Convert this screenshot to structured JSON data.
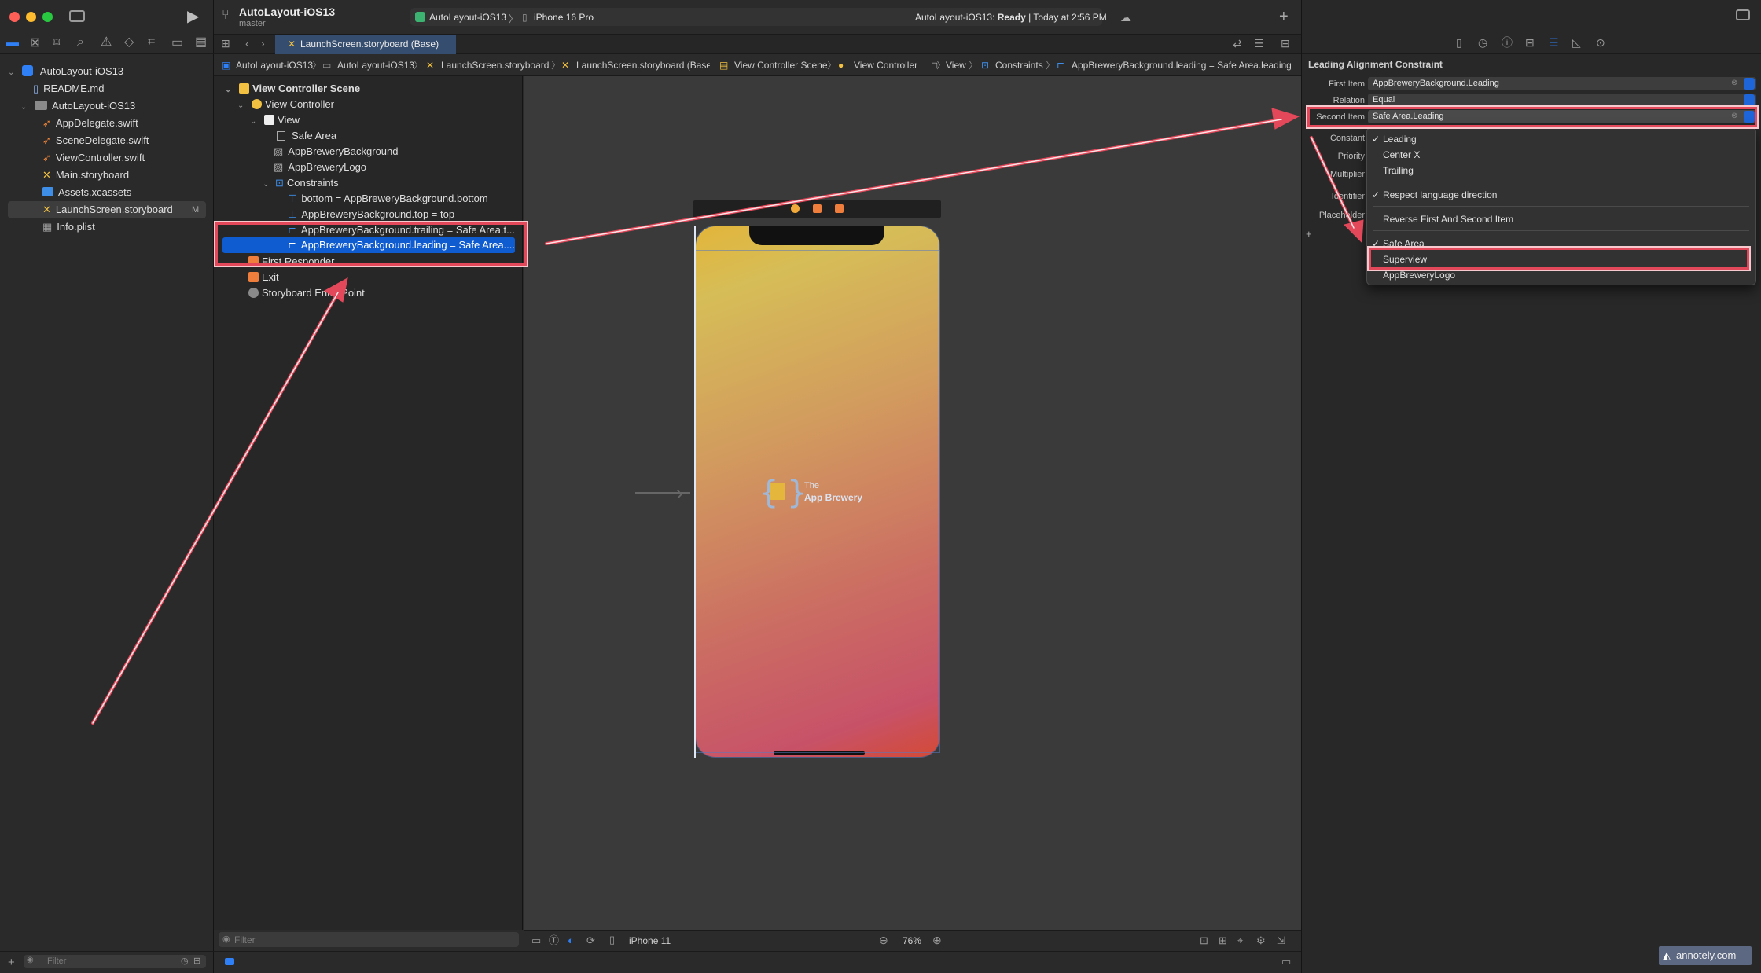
{
  "toolbar": {
    "project_title": "AutoLayout-iOS13",
    "branch": "master",
    "scheme": "AutoLayout-iOS13",
    "device": "iPhone 16 Pro",
    "status_prefix": "AutoLayout-iOS13: ",
    "status_state": "Ready",
    "status_time": " | Today at 2:56 PM"
  },
  "navigator": {
    "items": [
      {
        "label": "AutoLayout-iOS13",
        "kind": "project-icon"
      },
      {
        "label": "README.md",
        "kind": "book-icon"
      },
      {
        "label": "AutoLayout-iOS13",
        "kind": "folder-icon"
      },
      {
        "label": "AppDelegate.swift",
        "kind": "swift-icon"
      },
      {
        "label": "SceneDelegate.swift",
        "kind": "swift-icon"
      },
      {
        "label": "ViewController.swift",
        "kind": "swift-icon"
      },
      {
        "label": "Main.storyboard",
        "kind": "storyboard-icon"
      },
      {
        "label": "Assets.xcassets",
        "kind": "assets-icon"
      },
      {
        "label": "LaunchScreen.storyboard",
        "kind": "storyboard-icon",
        "badge": "M"
      },
      {
        "label": "Info.plist",
        "kind": "plist-icon"
      }
    ],
    "filter_placeholder": "Filter"
  },
  "editor": {
    "tab_label": "LaunchScreen.storyboard (Base)",
    "breadcrumb": [
      "AutoLayout-iOS13",
      "AutoLayout-iOS13",
      "LaunchScreen.storyboard",
      "LaunchScreen.storyboard (Base)",
      "View Controller Scene",
      "View Controller",
      "View",
      "Constraints",
      "AppBreweryBackground.leading = Safe Area.leading"
    ]
  },
  "outline": {
    "items": [
      {
        "label": "View Controller Scene"
      },
      {
        "label": "View Controller"
      },
      {
        "label": "View"
      },
      {
        "label": "Safe Area"
      },
      {
        "label": "AppBreweryBackground"
      },
      {
        "label": "AppBreweryLogo"
      },
      {
        "label": "Constraints"
      },
      {
        "label": "bottom = AppBreweryBackground.bottom"
      },
      {
        "label": "AppBreweryBackground.top = top"
      },
      {
        "label": "AppBreweryBackground.trailing = Safe Area.t..."
      },
      {
        "label": "AppBreweryBackground.leading = Safe Area...."
      },
      {
        "label": "First Responder"
      },
      {
        "label": "Exit"
      },
      {
        "label": "Storyboard Entry Point"
      }
    ],
    "filter_placeholder": "Filter"
  },
  "canvas": {
    "logo_line1": "The",
    "logo_line2": "App Brewery",
    "device_label": "iPhone 11",
    "zoom": "76%"
  },
  "inspector": {
    "title": "Leading Alignment Constraint",
    "first_item_label": "First Item",
    "first_item_value": "AppBreweryBackground.Leading",
    "relation_label": "Relation",
    "relation_value": "Equal",
    "second_item_label": "Second Item",
    "second_item_value": "Safe Area.Leading",
    "constant_label": "Constant",
    "priority_label": "Priority",
    "multiplier_label": "Multiplier",
    "identifier_label": "Identifier",
    "placeholder_label": "Placeholder",
    "menu": {
      "leading": "Leading",
      "center_x": "Center X",
      "trailing": "Trailing",
      "respect": "Respect language direction",
      "reverse": "Reverse First And Second Item",
      "safe_area": "Safe Area",
      "superview": "Superview",
      "logo": "AppBreweryLogo"
    }
  },
  "watermark": "annotely.com",
  "colors": {
    "accent": "#1d65d8",
    "highlight_red": "#e3485a",
    "gradient_top": "#d6bd57",
    "gradient_bottom": "#c75268"
  }
}
